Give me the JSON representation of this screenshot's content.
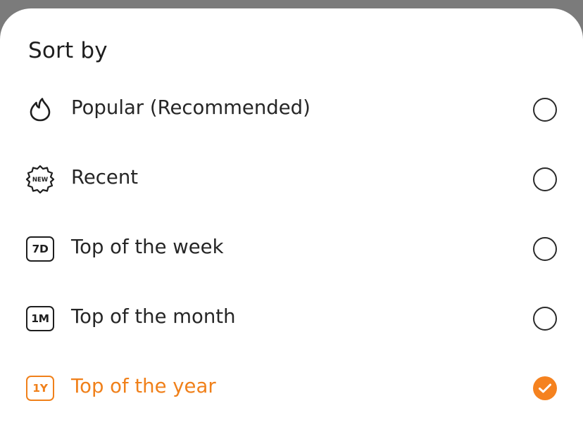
{
  "sheet": {
    "title": "Sort by"
  },
  "options": [
    {
      "label": "Popular (Recommended)",
      "icon": "flame-icon",
      "selected": false
    },
    {
      "label": "Recent",
      "icon": "new-badge-icon",
      "badge_text": "NEW",
      "selected": false
    },
    {
      "label": "Top of the week",
      "icon": "7d-badge-icon",
      "badge_text": "7D",
      "selected": false
    },
    {
      "label": "Top of the month",
      "icon": "1m-badge-icon",
      "badge_text": "1M",
      "selected": false
    },
    {
      "label": "Top of the year",
      "icon": "1y-badge-icon",
      "badge_text": "1Y",
      "selected": true
    }
  ],
  "colors": {
    "accent": "#f5821f",
    "text": "#262626",
    "scrim": "#7b7b7b"
  }
}
